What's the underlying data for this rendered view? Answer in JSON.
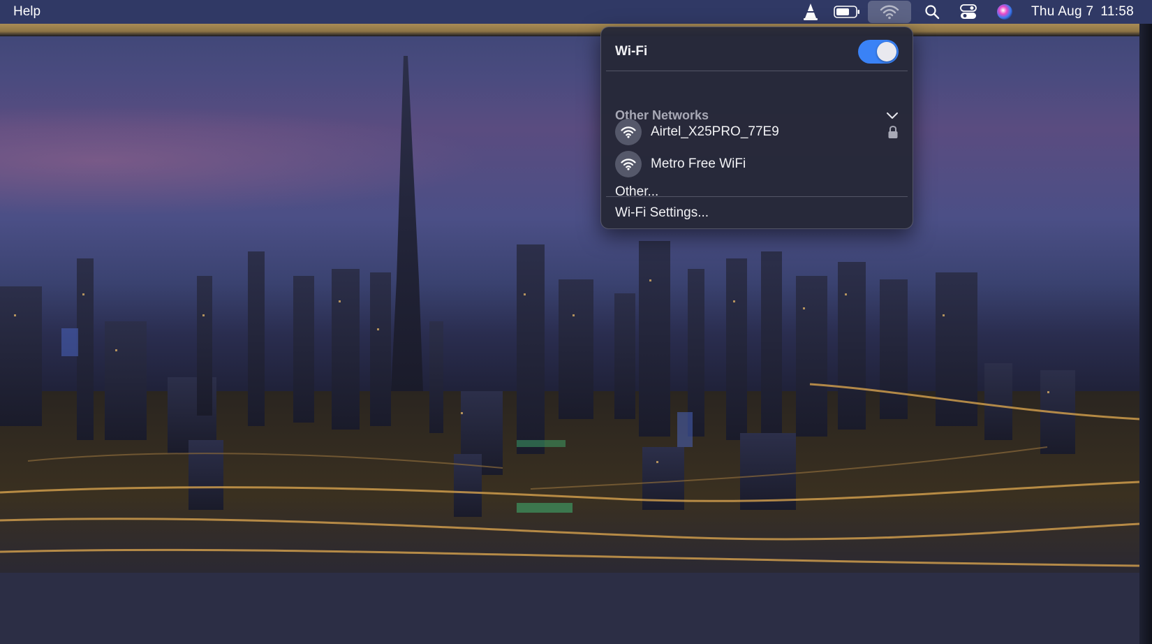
{
  "menubar": {
    "app_menu": "Help",
    "status_icons": [
      "vlc-cone-icon",
      "battery-icon",
      "wifi-icon",
      "spotlight-search-icon",
      "control-center-icon",
      "siri-icon"
    ],
    "clock": {
      "date": "Thu Aug 7",
      "time": "11:58"
    }
  },
  "wifi_menu": {
    "title": "Wi-Fi",
    "toggle_on": true,
    "section_label": "Other Networks",
    "networks": [
      {
        "name": "Airtel_X25PRO_77E9",
        "secured": true
      },
      {
        "name": "Metro Free WiFi",
        "secured": false
      }
    ],
    "other_label": "Other...",
    "settings_label": "Wi-Fi Settings..."
  },
  "colors": {
    "menubar": "#303864",
    "toggle_on": "#3a82f6",
    "panel_bg": "#262838",
    "section_label": "#a8a9b6"
  }
}
